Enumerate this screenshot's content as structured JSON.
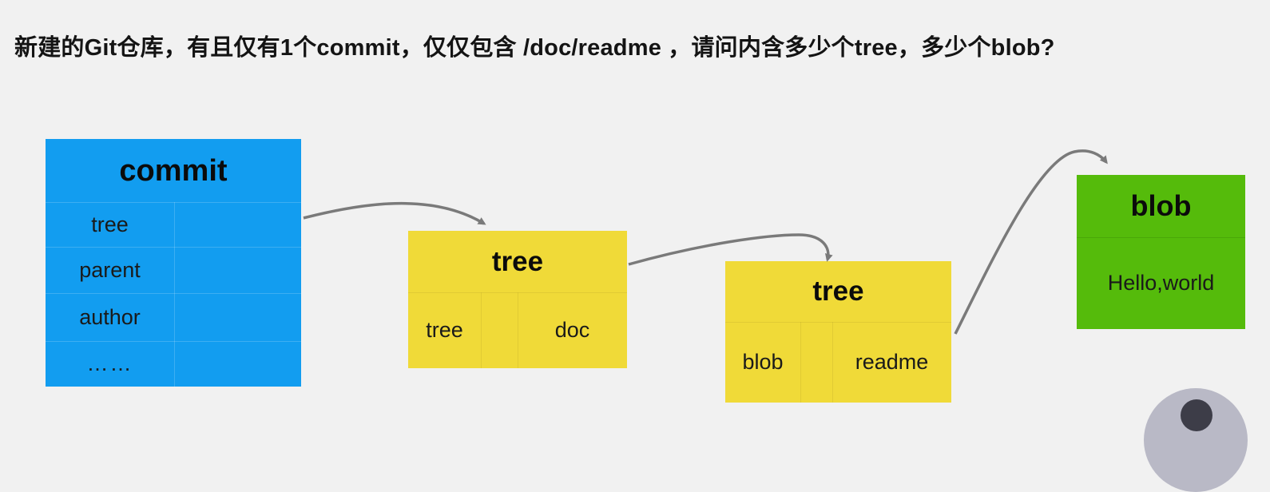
{
  "question": "新建的Git仓库，有且仅有1个commit，仅仅包含 /doc/readme ，请问内含多少个tree，多少个blob?",
  "colors": {
    "background": "#f1f1f1",
    "commit": "#129df0",
    "tree": "#f0da38",
    "blob": "#55bb0b",
    "arrow": "#7a7a7a"
  },
  "commit": {
    "title": "commit",
    "rows": [
      {
        "label": "tree",
        "value": ""
      },
      {
        "label": "parent",
        "value": ""
      },
      {
        "label": "author",
        "value": ""
      },
      {
        "label": "……",
        "value": ""
      }
    ]
  },
  "tree1": {
    "title": "tree",
    "entry": {
      "type": "tree",
      "name": "doc"
    }
  },
  "tree2": {
    "title": "tree",
    "entry": {
      "type": "blob",
      "name": "readme"
    }
  },
  "blob": {
    "title": "blob",
    "content": "Hello,world"
  },
  "arrows": [
    {
      "from": "commit.tree",
      "to": "tree1"
    },
    {
      "from": "tree1.doc",
      "to": "tree2"
    },
    {
      "from": "tree2.readme",
      "to": "blob"
    }
  ]
}
